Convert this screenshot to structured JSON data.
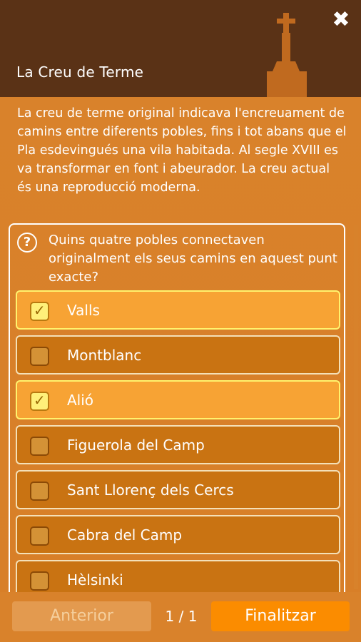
{
  "header": {
    "title": "La Creu de Terme",
    "close_label": "✖"
  },
  "description": "La creu de terme original indicava l'encreuament de camins entre diferents pobles, fins i tot abans que el Pla esdevingués una vila habitada. Al segle XVIII es va transformar en font i abeurador. La creu actual és una reproducció moderna.",
  "question": {
    "icon": "?",
    "text": "Quins quatre pobles connectaven originalment els seus camins en aquest punt exacte?"
  },
  "options": [
    {
      "label": "Valls",
      "selected": true
    },
    {
      "label": "Montblanc",
      "selected": false
    },
    {
      "label": "Alió",
      "selected": true
    },
    {
      "label": "Figuerola del Camp",
      "selected": false
    },
    {
      "label": "Sant Llorenç dels Cercs",
      "selected": false
    },
    {
      "label": "Cabra del Camp",
      "selected": false
    },
    {
      "label": "Hèlsinki",
      "selected": false
    }
  ],
  "footer": {
    "prev_label": "Anterior",
    "page_indicator": "1 / 1",
    "finish_label": "Finalitzar"
  },
  "colors": {
    "header_bg": "#5a3216",
    "body_bg": "#d9822b",
    "option_bg": "#c97312",
    "option_selected_bg": "#f7a334",
    "finish_bg": "#fb8c00"
  }
}
